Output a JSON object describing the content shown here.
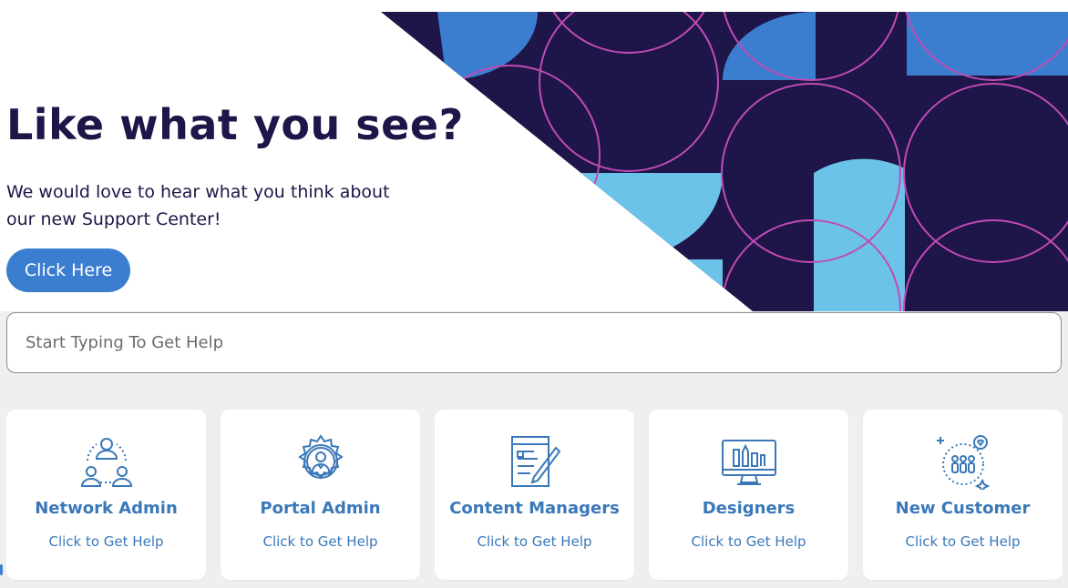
{
  "hero": {
    "title": "Like what you see?",
    "text": "We would love to hear what you think about our new Support Center!",
    "cta_label": "Click Here"
  },
  "search": {
    "placeholder": "Start Typing To Get Help"
  },
  "categories": [
    {
      "title": "Network Admin",
      "subtitle": "Click to Get Help",
      "icon": "network-users-icon"
    },
    {
      "title": "Portal Admin",
      "subtitle": "Click to Get Help",
      "icon": "gear-admin-icon"
    },
    {
      "title": "Content Managers",
      "subtitle": "Click to Get Help",
      "icon": "document-edit-icon"
    },
    {
      "title": "Designers",
      "subtitle": "Click to Get Help",
      "icon": "design-monitor-icon"
    },
    {
      "title": "New Customer",
      "subtitle": "Click to Get Help",
      "icon": "customer-group-icon"
    }
  ],
  "colors": {
    "navy": "#1e1548",
    "accent_blue": "#3b7ecf",
    "light_blue": "#6cc3ea",
    "magenta_lines": "#c04bb5",
    "card_text": "#3a78b8"
  }
}
